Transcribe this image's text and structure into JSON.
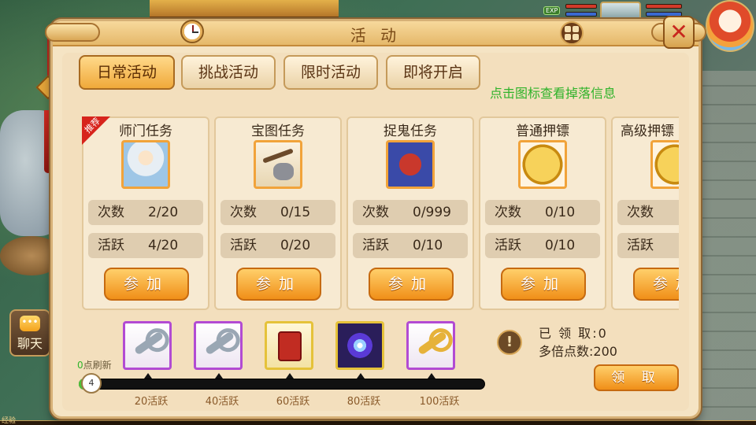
{
  "panel": {
    "title": "活 动"
  },
  "tabs": [
    {
      "label": "日常活动",
      "active": true
    },
    {
      "label": "挑战活动",
      "active": false
    },
    {
      "label": "限时活动",
      "active": false
    },
    {
      "label": "即将开启",
      "active": false
    }
  ],
  "hint": "点击图标查看掉落信息",
  "activities": [
    {
      "name": "师门任务",
      "icon": "master-portrait-icon",
      "recommended": "推荐",
      "count_label": "次数",
      "count": "2/20",
      "active_label": "活跃",
      "active": "4/20",
      "join_label": "参加"
    },
    {
      "name": "宝图任务",
      "icon": "pickaxe-ore-icon",
      "count_label": "次数",
      "count": "0/15",
      "active_label": "活跃",
      "active": "0/20",
      "join_label": "参加"
    },
    {
      "name": "捉鬼任务",
      "icon": "ghost-mask-icon",
      "count_label": "次数",
      "count": "0/999",
      "active_label": "活跃",
      "active": "0/10",
      "join_label": "参加"
    },
    {
      "name": "普通押镖",
      "icon": "escort-coin-icon",
      "count_label": "次数",
      "count": "0/10",
      "active_label": "活跃",
      "active": "0/10",
      "join_label": "参加"
    },
    {
      "name": "高级押镖",
      "icon": "escort-coin-icon",
      "count_label": "次数",
      "count": "",
      "active_label": "活跃",
      "active": "",
      "join_label": "参加"
    }
  ],
  "rewards": [
    {
      "icon": "silver-key-icon",
      "milestone": "20活跃"
    },
    {
      "icon": "silver-key-icon",
      "milestone": "40活跃"
    },
    {
      "icon": "red-pouch-icon",
      "milestone": "60活跃"
    },
    {
      "icon": "purple-orb-icon",
      "milestone": "80活跃"
    },
    {
      "icon": "gold-key-icon",
      "milestone": "100活跃"
    }
  ],
  "progress": {
    "value": 4,
    "max": 100,
    "knob_label": "4",
    "refresh_count": "0",
    "refresh_label": "点刷新"
  },
  "claimed": {
    "received_label": "已 领 取",
    "received_value": "0",
    "multiplier_label": "多倍点数",
    "multiplier_value": "200"
  },
  "claim_button": "领 取",
  "chat_button": "聊天",
  "status": {
    "exp_badge": "EXP"
  },
  "footer": {
    "exp_label": "经验"
  },
  "colors": {
    "accent": "#f08f18",
    "hint_green": "#2fb32a",
    "panel_bg": "#f5e4c4"
  }
}
